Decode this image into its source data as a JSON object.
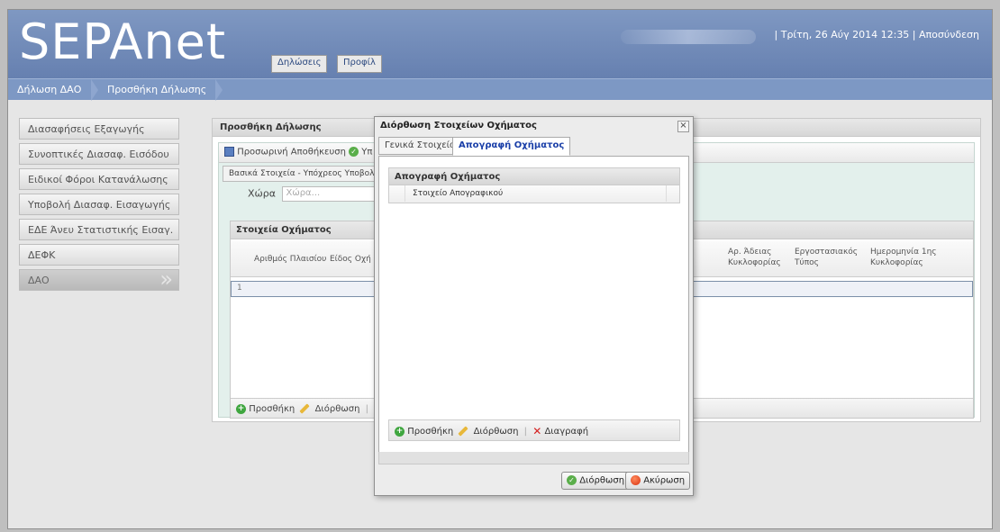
{
  "header": {
    "logo": "SEPAnet",
    "tabs": [
      "Δηλώσεις",
      "Προφίλ"
    ],
    "datetime": "| Τρίτη, 26 Αύγ 2014 12:35 |",
    "logout": "Αποσύνδεση"
  },
  "breadcrumb": [
    "Δήλωση ΔΑΟ",
    "Προσθήκη Δήλωσης"
  ],
  "sidebar": {
    "items": [
      {
        "label": "Διασαφήσεις Εξαγωγής"
      },
      {
        "label": "Συνοπτικές Διασαφ. Εισόδου"
      },
      {
        "label": "Ειδικοί Φόροι Κατανάλωσης"
      },
      {
        "label": "Υποβολή Διασαφ. Εισαγωγής"
      },
      {
        "label": "ΕΔΕ Άνευ Στατιστικής Εισαγ."
      },
      {
        "label": "ΔΕΦΚ"
      },
      {
        "label": "ΔΑΟ"
      }
    ],
    "active_index": 6
  },
  "main": {
    "title": "Προσθήκη Δήλωσης",
    "toolbar": {
      "temp_save": "Προσωρινή Αποθήκευση",
      "submit_partial": "Υπ"
    },
    "subtab": "Βασικά Στοιχεία - Υπόχρεος Υποβολή",
    "country_label": "Χώρα",
    "country_placeholder": "Χώρα...",
    "grid": {
      "title": "Στοιχεία Οχήματος",
      "columns": [
        "Αριθμός Πλαισίου",
        "Είδος Οχή",
        "Αρ. Άδειας Κυκλοφορίας",
        "Εργοστασιακός Τύπος",
        "Ημερομηνία 1ης Κυκλοφορίας"
      ],
      "rows": [
        {
          "num": "1"
        }
      ]
    },
    "footer": {
      "add": "Προσθήκη",
      "edit": "Διόρθωση"
    }
  },
  "modal": {
    "title": "Διόρθωση Στοιχείων Οχήματος",
    "close_glyph": "×",
    "tabs": [
      {
        "label": "Γενικά Στοιχεία",
        "active": false
      },
      {
        "label": "Απογραφή Οχήματος",
        "active": true
      }
    ],
    "grid": {
      "title": "Απογραφή Οχήματος",
      "column": "Στοιχείο Απογραφικού"
    },
    "footer": {
      "add": "Προσθήκη",
      "edit": "Διόρθωση",
      "delete": "Διαγραφή"
    },
    "buttons": {
      "save": "Διόρθωση",
      "cancel": "Ακύρωση"
    }
  }
}
